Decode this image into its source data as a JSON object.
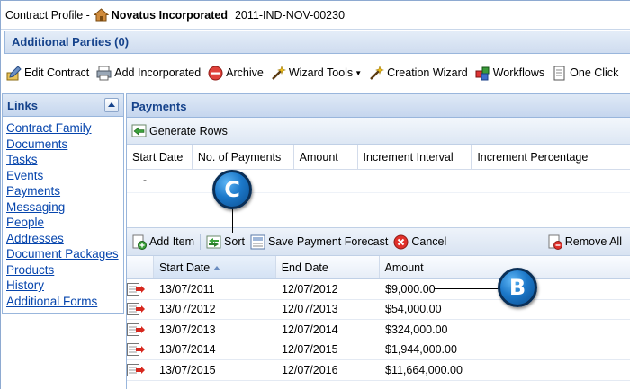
{
  "title": {
    "prefix": "Contract Profile -",
    "company": "Novatus Incorporated",
    "contract_id": "2011-IND-NOV-00230"
  },
  "parties": {
    "label": "Additional Parties (0)"
  },
  "toolbar": {
    "edit_contract": "Edit Contract",
    "add_incorporated": "Add Incorporated",
    "archive": "Archive",
    "wizard_tools": "Wizard Tools",
    "creation_wizard": "Creation Wizard",
    "workflows": "Workflows",
    "one_click": "One Click"
  },
  "links": {
    "title": "Links",
    "items": [
      "Contract Family",
      "Documents",
      "Tasks",
      "Events",
      "Payments",
      "Messaging",
      "People",
      "Addresses",
      "Document Packages",
      "Products",
      "History",
      "Additional Forms"
    ]
  },
  "payments": {
    "title": "Payments",
    "generate_rows": "Generate Rows",
    "schedule_columns": [
      "Start Date",
      "No. of Payments",
      "Amount",
      "Increment Interval",
      "Increment Percentage"
    ],
    "schedule_row_value": "-",
    "grid_toolbar": {
      "add_item": "Add Item",
      "sort": "Sort",
      "save_forecast": "Save Payment Forecast",
      "cancel": "Cancel",
      "remove_all": "Remove All"
    },
    "grid_columns": [
      "Start Date",
      "End Date",
      "Amount"
    ],
    "rows": [
      {
        "start": "13/07/2011",
        "end": "12/07/2012",
        "amount": "$9,000.00"
      },
      {
        "start": "13/07/2012",
        "end": "12/07/2013",
        "amount": "$54,000.00"
      },
      {
        "start": "13/07/2013",
        "end": "12/07/2014",
        "amount": "$324,000.00"
      },
      {
        "start": "13/07/2014",
        "end": "12/07/2015",
        "amount": "$1,944,000.00"
      },
      {
        "start": "13/07/2015",
        "end": "12/07/2016",
        "amount": "$11,664,000.00"
      }
    ]
  },
  "callouts": {
    "c": "C",
    "b": "B"
  },
  "colors": {
    "header_text": "#15428b",
    "link": "#0645ad",
    "callout": "#1c78c9"
  }
}
